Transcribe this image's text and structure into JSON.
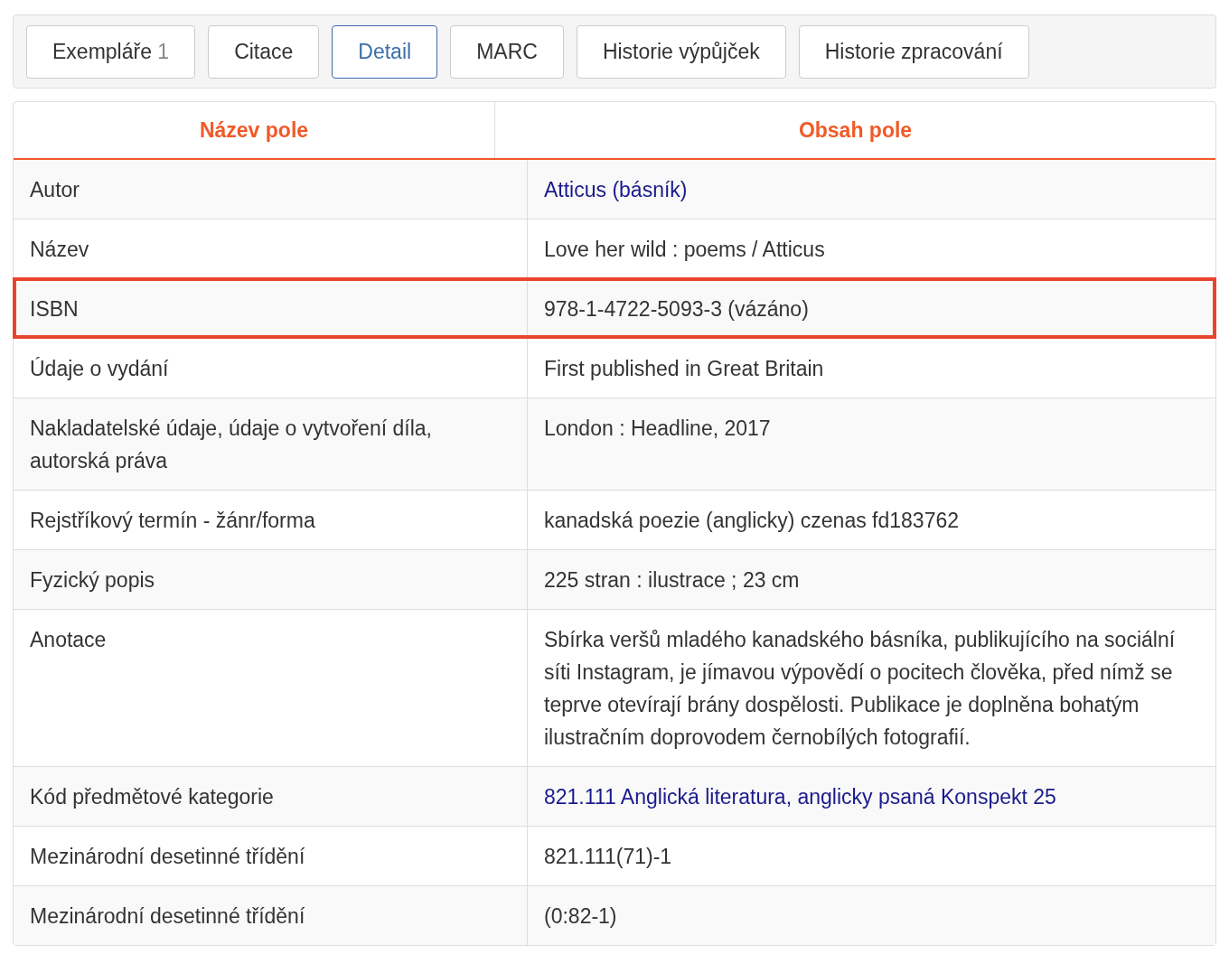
{
  "tabs": [
    {
      "label": "Exempláře",
      "count": "1",
      "selected": false
    },
    {
      "label": "Citace",
      "selected": false
    },
    {
      "label": "Detail",
      "selected": true
    },
    {
      "label": "MARC",
      "selected": false
    },
    {
      "label": "Historie výpůjček",
      "selected": false
    },
    {
      "label": "Historie zpracování",
      "selected": false
    }
  ],
  "table": {
    "columns": [
      "Název pole",
      "Obsah pole"
    ],
    "rows": [
      {
        "field": "Autor",
        "value": "Atticus (básník)",
        "kind": "link",
        "highlighted": false
      },
      {
        "field": "Název",
        "value": "Love her wild : poems / Atticus",
        "kind": "text",
        "highlighted": false
      },
      {
        "field": "ISBN",
        "value": "978-1-4722-5093-3 (vázáno)",
        "kind": "text",
        "highlighted": true
      },
      {
        "field": "Údaje o vydání",
        "value": "First published in Great Britain",
        "kind": "text",
        "highlighted": false
      },
      {
        "field": "Nakladatelské údaje, údaje o vytvoření díla, autorská práva",
        "value": "London : Headline, 2017",
        "kind": "text",
        "highlighted": false
      },
      {
        "field": "Rejstříkový termín - žánr/forma",
        "value": "kanadská poezie (anglicky) czenas fd183762",
        "kind": "text",
        "highlighted": false
      },
      {
        "field": "Fyzický popis",
        "value": "225 stran : ilustrace ; 23 cm",
        "kind": "text",
        "highlighted": false
      },
      {
        "field": "Anotace",
        "value": "Sbírka veršů mladého kanadského básníka, publikujícího na sociální síti Instagram, je jímavou výpovědí o pocitech člověka, před nímž se teprve otevírají brány dospělosti. Publikace je doplněna bohatým ilustračním doprovodem černobílých fotografií.",
        "kind": "text",
        "highlighted": false
      },
      {
        "field": "Kód předmětové kategorie",
        "value": "821.111 Anglická literatura, anglicky psaná Konspekt 25",
        "kind": "link",
        "highlighted": false
      },
      {
        "field": "Mezinárodní desetinné třídění",
        "value": "821.111(71)-1",
        "kind": "text",
        "highlighted": false
      },
      {
        "field": "Mezinárodní desetinné třídění",
        "value": "(0:82-1)",
        "kind": "text",
        "highlighted": false
      }
    ]
  }
}
